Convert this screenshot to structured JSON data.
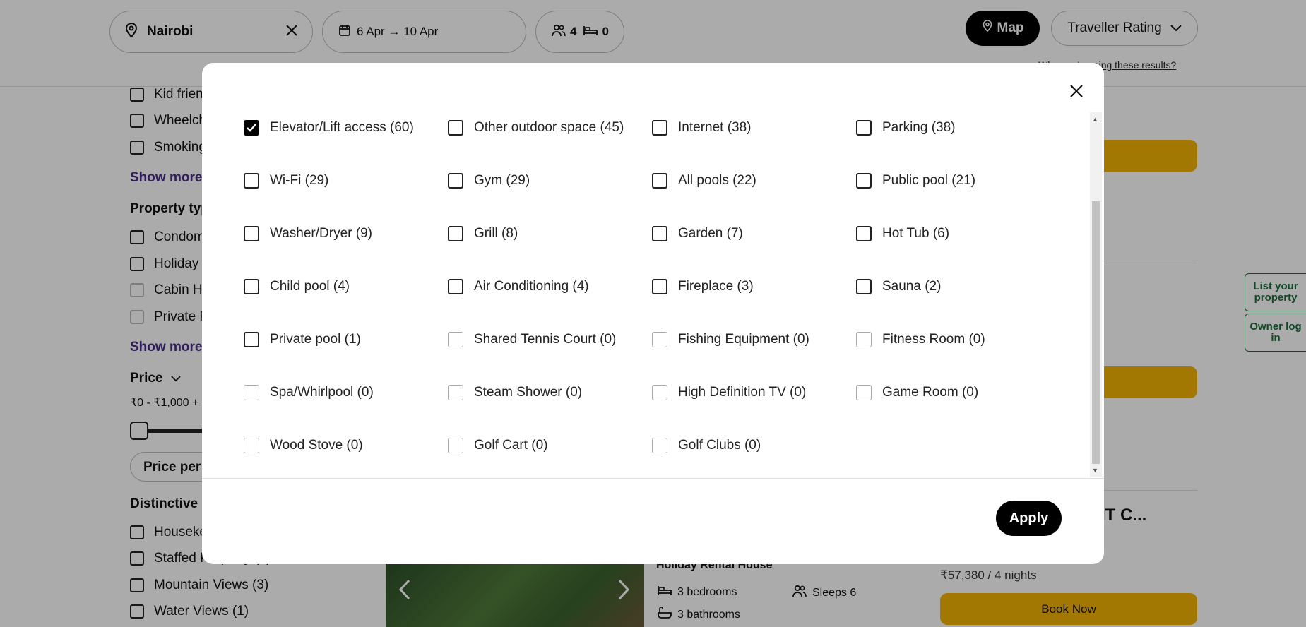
{
  "header": {
    "location": "Nairobi",
    "dates": "6 Apr → 10 Apr",
    "guests": "4",
    "bedrooms": "0",
    "map_label": "Map",
    "sort_label": "Traveller Rating",
    "why_link": "Why am I seeing these results?"
  },
  "sidebar": {
    "features": [
      "Kid friendly",
      "Wheelchair accessible",
      "Smoking allowed"
    ],
    "show_more_1": "Show more",
    "property_type_heading": "Property type",
    "property_types": [
      "Condominium",
      "Holiday Rental House",
      "Cabin Holiday",
      "Private Room"
    ],
    "show_more_2": "Show more",
    "price_heading": "Price",
    "price_range": "₹0 - ₹1,000 +",
    "price_per": "Price per night",
    "distinctive_heading": "Distinctive Features",
    "distinctive": [
      "Housekeeping (3)",
      "Staffed Property (3)",
      "Mountain Views (3)",
      "Water Views (1)"
    ]
  },
  "listing": {
    "type": "Holiday Rental House",
    "bedrooms": "3 bedrooms",
    "bathrooms": "3 bathrooms",
    "sleeps": "Sleeps 6",
    "title": "o SARIT C...",
    "price": "₹57,380 / 4 nights",
    "book_label": "Book Now"
  },
  "side_tabs": {
    "list_property": "List your property",
    "owner_login": "Owner log in"
  },
  "modal": {
    "options": [
      {
        "label": "Elevator/Lift access (60)",
        "checked": true,
        "zero": false
      },
      {
        "label": "Other outdoor space (45)",
        "checked": false,
        "zero": false
      },
      {
        "label": "Internet (38)",
        "checked": false,
        "zero": false
      },
      {
        "label": "Parking (38)",
        "checked": false,
        "zero": false
      },
      {
        "label": "Wi-Fi (29)",
        "checked": false,
        "zero": false
      },
      {
        "label": "Gym (29)",
        "checked": false,
        "zero": false
      },
      {
        "label": "All pools (22)",
        "checked": false,
        "zero": false
      },
      {
        "label": "Public pool (21)",
        "checked": false,
        "zero": false
      },
      {
        "label": "Washer/Dryer (9)",
        "checked": false,
        "zero": false
      },
      {
        "label": "Grill (8)",
        "checked": false,
        "zero": false
      },
      {
        "label": "Garden (7)",
        "checked": false,
        "zero": false
      },
      {
        "label": "Hot Tub (6)",
        "checked": false,
        "zero": false
      },
      {
        "label": "Child pool (4)",
        "checked": false,
        "zero": false
      },
      {
        "label": "Air Conditioning (4)",
        "checked": false,
        "zero": false
      },
      {
        "label": "Fireplace (3)",
        "checked": false,
        "zero": false
      },
      {
        "label": "Sauna (2)",
        "checked": false,
        "zero": false
      },
      {
        "label": "Private pool (1)",
        "checked": false,
        "zero": false
      },
      {
        "label": "Shared Tennis Court (0)",
        "checked": false,
        "zero": true
      },
      {
        "label": "Fishing Equipment (0)",
        "checked": false,
        "zero": true
      },
      {
        "label": "Fitness Room (0)",
        "checked": false,
        "zero": true
      },
      {
        "label": "Spa/Whirlpool (0)",
        "checked": false,
        "zero": true
      },
      {
        "label": "Steam Shower (0)",
        "checked": false,
        "zero": true
      },
      {
        "label": "High Definition TV (0)",
        "checked": false,
        "zero": true
      },
      {
        "label": "Game Room (0)",
        "checked": false,
        "zero": true
      },
      {
        "label": "Wood Stove (0)",
        "checked": false,
        "zero": true
      },
      {
        "label": "Golf Cart (0)",
        "checked": false,
        "zero": true
      },
      {
        "label": "Golf Clubs (0)",
        "checked": false,
        "zero": true
      }
    ],
    "apply_label": "Apply"
  }
}
